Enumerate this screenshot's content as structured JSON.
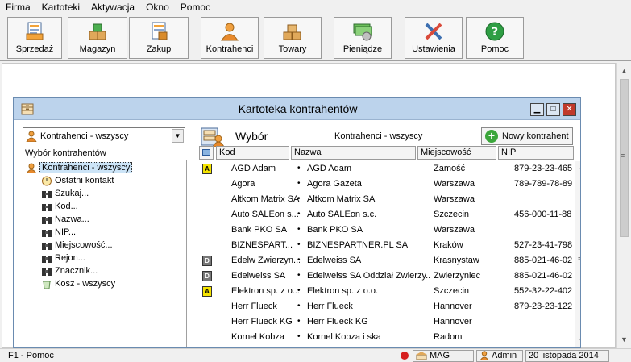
{
  "menu": [
    "Firma",
    "Kartoteki",
    "Aktywacja",
    "Okno",
    "Pomoc"
  ],
  "toolbar": {
    "sprzedaz": "Sprzedaż",
    "magazyn": "Magazyn",
    "zakup": "Zakup",
    "kontrahenci": "Kontrahenci",
    "towary": "Towary",
    "pieniadze": "Pieniądze",
    "ustawienia": "Ustawienia",
    "pomoc": "Pomoc"
  },
  "window": {
    "title": "Kartoteka kontrahentów",
    "filter_combo": "Kontrahenci - wszyscy",
    "tree_label": "Wybór kontrahentów",
    "tree": [
      "Kontrahenci - wszyscy",
      "Ostatni kontakt",
      "Szukaj...",
      "Kod...",
      "Nazwa...",
      "NIP...",
      "Miejscowość...",
      "Rejon...",
      "Znacznik...",
      "Kosz - wszyscy"
    ],
    "right_heading": "Wybór",
    "right_filter": "Kontrahenci - wszyscy",
    "new_button": "Nowy kontrahent",
    "columns": {
      "kod": "Kod",
      "nazwa": "Nazwa",
      "miejscowosc": "Miejscowość",
      "nip": "NIP"
    },
    "rows": [
      {
        "badge": "A",
        "kod": "AGD Adam",
        "nazwa": "AGD Adam",
        "miejscowosc": "Zamość",
        "nip": "879-23-23-465"
      },
      {
        "badge": "",
        "kod": "Agora",
        "nazwa": "Agora Gazeta",
        "miejscowosc": "Warszawa",
        "nip": "789-789-78-89"
      },
      {
        "badge": "",
        "kod": "Altkom Matrix SA",
        "nazwa": "Altkom Matrix SA",
        "miejscowosc": "Warszawa",
        "nip": ""
      },
      {
        "badge": "",
        "kod": "Auto SALEon s...",
        "nazwa": "Auto SALEon s.c.",
        "miejscowosc": "Szczecin",
        "nip": "456-000-11-88"
      },
      {
        "badge": "",
        "kod": "Bank PKO SA",
        "nazwa": "Bank PKO SA",
        "miejscowosc": "Warszawa",
        "nip": ""
      },
      {
        "badge": "",
        "kod": "BIZNESPART...",
        "nazwa": "BIZNESPARTNER.PL SA",
        "miejscowosc": "Kraków",
        "nip": "527-23-41-798"
      },
      {
        "badge": "D",
        "kod": "Edelw Zwierzyn...",
        "nazwa": "Edelweiss SA",
        "miejscowosc": "Krasnystaw",
        "nip": "885-021-46-02"
      },
      {
        "badge": "D",
        "kod": "Edelweiss SA",
        "nazwa": "Edelweiss SA Oddział Zwierzy...",
        "miejscowosc": "Zwierzyniec",
        "nip": "885-021-46-02"
      },
      {
        "badge": "A",
        "kod": "Elektron sp. z o...",
        "nazwa": "Elektron sp. z o.o.",
        "miejscowosc": "Szczecin",
        "nip": "552-32-22-402"
      },
      {
        "badge": "",
        "kod": "Herr Flueck",
        "nazwa": "Herr Flueck",
        "miejscowosc": "Hannover",
        "nip": "879-23-23-122"
      },
      {
        "badge": "",
        "kod": "Herr Flueck KG",
        "nazwa": "Herr Flueck KG",
        "miejscowosc": "Hannover",
        "nip": ""
      },
      {
        "badge": "",
        "kod": "Kornel Kobza",
        "nazwa": "Kornel Kobza i ska",
        "miejscowosc": "Radom",
        "nip": ""
      }
    ]
  },
  "status": {
    "help": "F1 - Pomoc",
    "mag": "MAG",
    "user": "Admin",
    "date": "20 listopada 2014"
  },
  "colors": {
    "title_bar": "#bcd3ec",
    "close": "#c0392b",
    "accent_yellow": "#f5e400"
  }
}
